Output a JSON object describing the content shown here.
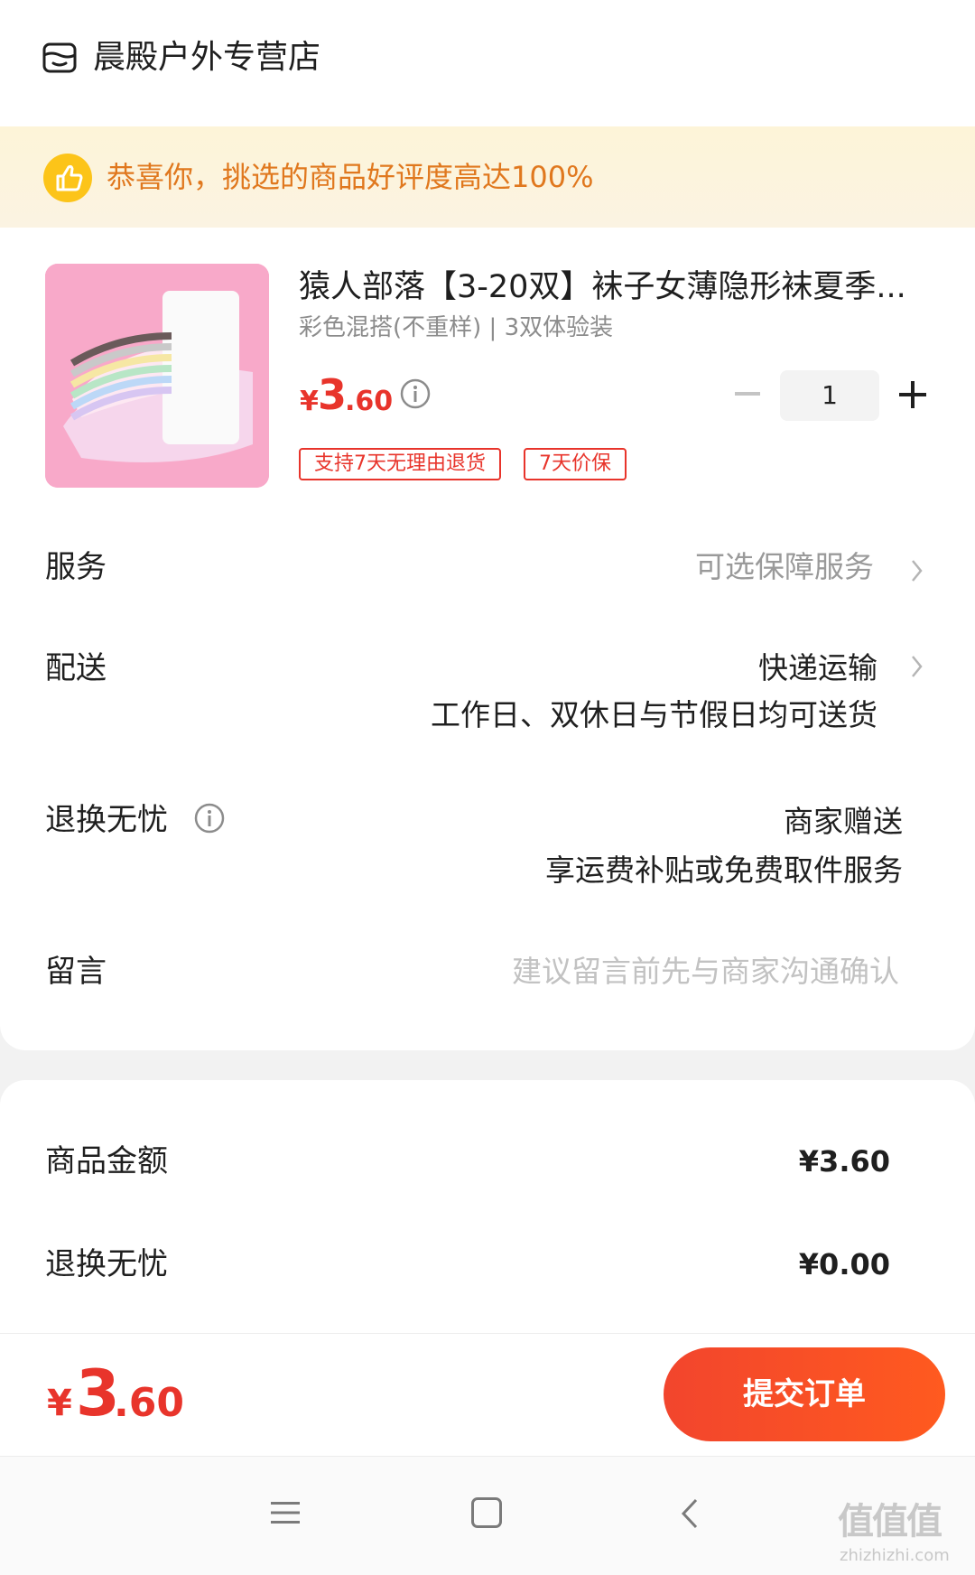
{
  "store": {
    "name": "晨殿户外专营店",
    "icon": "store-icon"
  },
  "banner": {
    "text": "恭喜你，挑选的商品好评度高达100%",
    "icon": "thumbs-up-icon"
  },
  "product": {
    "title": "猿人部落【3-20双】袜子女薄隐形袜夏季...",
    "variant": "彩色混搭(不重样) | 3双体验装",
    "price_symbol": "¥",
    "price_int": "3",
    "price_dec": ".60",
    "quantity": "1",
    "tags": [
      "支持7天无理由退货",
      "7天价保"
    ]
  },
  "rows": {
    "service": {
      "label": "服务",
      "value": "可选保障服务"
    },
    "delivery": {
      "label": "配送",
      "value": "快递运输",
      "detail": "工作日、双休日与节假日均可送货"
    },
    "returns": {
      "label": "退换无忧",
      "value": "商家赠送",
      "detail": "享运费补贴或免费取件服务"
    },
    "message": {
      "label": "留言",
      "placeholder": "建议留言前先与商家沟通确认"
    }
  },
  "summary": {
    "goods_label": "商品金额",
    "goods_value": "¥3.60",
    "returns_label": "退换无忧",
    "returns_value": "¥0.00"
  },
  "footer": {
    "total_symbol": "¥",
    "total_int": "3",
    "total_dec": ".60",
    "submit_label": "提交订单"
  },
  "watermark": {
    "main": "值值值",
    "sub": "zhizhizhi.com"
  },
  "colors": {
    "accent": "#e8342b",
    "banner_text": "#e0781e",
    "banner_bg": "#fdf4d8",
    "submit_bg": "#f2452d"
  }
}
